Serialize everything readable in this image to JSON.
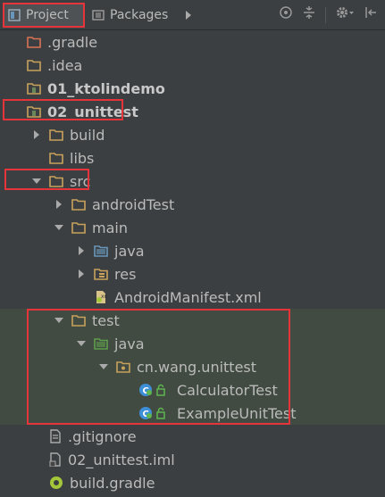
{
  "toolbar": {
    "tabs": [
      {
        "label": "Project",
        "icon": "project-icon",
        "active": true
      },
      {
        "label": "Packages",
        "icon": "packages-icon",
        "active": false
      }
    ],
    "more_icon": "triangle-right-icon",
    "actions": [
      "target-icon",
      "collapse-icon",
      "gear-icon",
      "hide-icon"
    ]
  },
  "tree": [
    {
      "label": ".gradle",
      "depth": 0,
      "icon": "folder-orange-icon"
    },
    {
      "label": ".idea",
      "depth": 0,
      "icon": "folder-icon"
    },
    {
      "label": "01_ktolindemo",
      "depth": 0,
      "icon": "module-folder-icon",
      "bold": true
    },
    {
      "label": "02_unittest",
      "depth": 0,
      "icon": "module-folder-icon",
      "bold": true
    },
    {
      "label": "build",
      "depth": 1,
      "icon": "folder-icon",
      "arrow": "collapsed"
    },
    {
      "label": "libs",
      "depth": 1,
      "icon": "folder-icon"
    },
    {
      "label": "src",
      "depth": 1,
      "icon": "folder-icon",
      "arrow": "expanded"
    },
    {
      "label": "androidTest",
      "depth": 2,
      "icon": "folder-icon",
      "arrow": "collapsed"
    },
    {
      "label": "main",
      "depth": 2,
      "icon": "folder-icon",
      "arrow": "expanded"
    },
    {
      "label": "java",
      "depth": 3,
      "icon": "source-folder-icon",
      "arrow": "collapsed"
    },
    {
      "label": "res",
      "depth": 3,
      "icon": "resource-folder-icon",
      "arrow": "collapsed"
    },
    {
      "label": "AndroidManifest.xml",
      "depth": 3,
      "icon": "manifest-icon"
    },
    {
      "label": "test",
      "depth": 2,
      "icon": "folder-icon",
      "arrow": "expanded"
    },
    {
      "label": "java",
      "depth": 3,
      "icon": "test-folder-icon",
      "arrow": "expanded"
    },
    {
      "label": "cn.wang.unittest",
      "depth": 4,
      "icon": "package-icon",
      "arrow": "expanded"
    },
    {
      "label": "CalculatorTest",
      "depth": 5,
      "icon": "test-class-icon"
    },
    {
      "label": "ExampleUnitTest",
      "depth": 5,
      "icon": "test-class-icon"
    },
    {
      "label": ".gitignore",
      "depth": 1,
      "icon": "text-file-icon"
    },
    {
      "label": "02_unittest.iml",
      "depth": 1,
      "icon": "iml-file-icon"
    },
    {
      "label": "build.gradle",
      "depth": 1,
      "icon": "gradle-icon"
    }
  ],
  "colors": {
    "highlight": "#e5343a",
    "selection": "#414b42",
    "folder": "#c8a25b",
    "source_folder": "#6897bb",
    "test_folder": "#5d9e4b"
  }
}
